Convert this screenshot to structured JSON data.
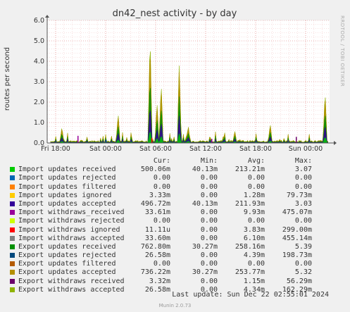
{
  "title": "dn42_nest activity - by day",
  "ylabel": "routes per second",
  "side_text": "RRDTOOL / TOBI OETIKER",
  "chart_data": {
    "type": "area",
    "title": "dn42_nest activity - by day",
    "ylabel": "routes per second",
    "xlabel": "",
    "ylim": [
      0,
      6.0
    ],
    "yticks": [
      "0.0",
      "1.0",
      "2.0",
      "3.0",
      "4.0",
      "5.0",
      "6.0"
    ],
    "xticks": [
      "Fri 18:00",
      "Sat 00:00",
      "Sat 06:00",
      "Sat 12:00",
      "Sat 18:00",
      "Sun 00:00"
    ],
    "grid": true,
    "peaks": [
      {
        "x": "Fri 18:45",
        "y": 0.78
      },
      {
        "x": "Sat 01:30",
        "y": 1.45
      },
      {
        "x": "Sat 05:20",
        "y": 5.35
      },
      {
        "x": "Sat 06:10",
        "y": 2.0
      },
      {
        "x": "Sat 06:40",
        "y": 2.95
      },
      {
        "x": "Sat 08:50",
        "y": 3.95
      },
      {
        "x": "Sat 09:55",
        "y": 0.85
      },
      {
        "x": "Sat 15:30",
        "y": 0.6
      },
      {
        "x": "Sat 19:45",
        "y": 0.95
      },
      {
        "x": "Sun 02:20",
        "y": 2.55
      }
    ],
    "series": [
      {
        "name": "Import updates received",
        "color": "#00cc00",
        "cur": "500.06m",
        "min": "40.13m",
        "avg": "213.21m",
        "max": "3.07"
      },
      {
        "name": "Import updates rejected",
        "color": "#0066b3",
        "cur": "0.00",
        "min": "0.00",
        "avg": "0.00",
        "max": "0.00"
      },
      {
        "name": "Import updates filtered",
        "color": "#ff8000",
        "cur": "0.00",
        "min": "0.00",
        "avg": "0.00",
        "max": "0.00"
      },
      {
        "name": "Import updates ignored",
        "color": "#ffcc00",
        "cur": "3.33m",
        "min": "0.00",
        "avg": "1.28m",
        "max": "79.73m"
      },
      {
        "name": "Import updates accepted",
        "color": "#330099",
        "cur": "496.72m",
        "min": "40.13m",
        "avg": "211.93m",
        "max": "3.03"
      },
      {
        "name": "Import withdraws_received",
        "color": "#990099",
        "cur": "33.61m",
        "min": "0.00",
        "avg": "9.93m",
        "max": "475.07m"
      },
      {
        "name": "Import withdraws rejected",
        "color": "#ccff00",
        "cur": "0.00",
        "min": "0.00",
        "avg": "0.00",
        "max": "0.00"
      },
      {
        "name": "Import withdraws ignored",
        "color": "#ff0000",
        "cur": "11.11u",
        "min": "0.00",
        "avg": "3.83m",
        "max": "299.00m"
      },
      {
        "name": "Import withdraws accepted",
        "color": "#808080",
        "cur": "33.60m",
        "min": "0.00",
        "avg": "6.10m",
        "max": "455.14m"
      },
      {
        "name": "Export updates received",
        "color": "#008f00",
        "cur": "762.80m",
        "min": "30.27m",
        "avg": "258.16m",
        "max": "5.39"
      },
      {
        "name": "Export updates rejected",
        "color": "#00487d",
        "cur": "26.58m",
        "min": "0.00",
        "avg": "4.39m",
        "max": "198.73m"
      },
      {
        "name": "Export updates filtered",
        "color": "#b35a00",
        "cur": "0.00",
        "min": "0.00",
        "avg": "0.00",
        "max": "0.00"
      },
      {
        "name": "Export updates accepted",
        "color": "#b38f00",
        "cur": "736.22m",
        "min": "30.27m",
        "avg": "253.77m",
        "max": "5.32"
      },
      {
        "name": "Export withdraws received",
        "color": "#6b006b",
        "cur": "3.32m",
        "min": "0.00",
        "avg": "1.15m",
        "max": "56.29m"
      },
      {
        "name": "Export withdraws accepted",
        "color": "#8fb300",
        "cur": "26.58m",
        "min": "0.00",
        "avg": "4.34m",
        "max": "162.29m"
      }
    ]
  },
  "legend_headers": {
    "cur": "Cur:",
    "min": "Min:",
    "avg": "Avg:",
    "max": "Max:"
  },
  "last_update": "Last update: Sun Dec 22 02:55:01 2024",
  "version": "Munin 2.0.73"
}
